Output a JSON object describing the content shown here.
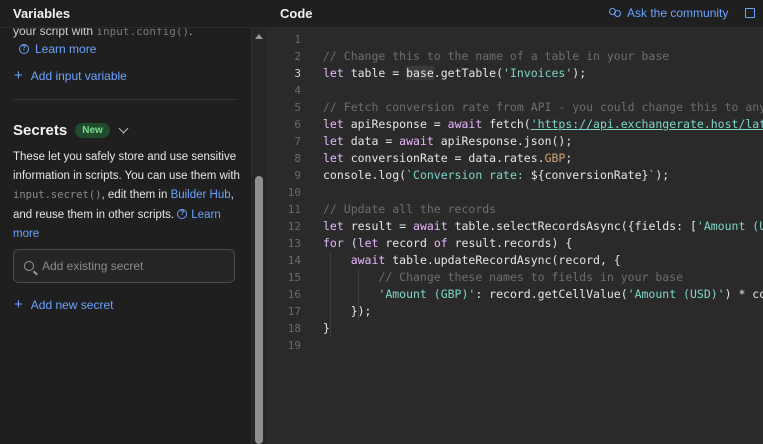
{
  "left_panel": {
    "title": "Variables",
    "partial_line_text": "your script with ",
    "partial_line_code": "input.config()",
    "partial_line_tail": ".",
    "learn_more_1": "Learn more",
    "add_input_variable": "Add input variable",
    "secrets": {
      "title": "Secrets",
      "badge": "New",
      "desc_part1": "These let you safely store and use sensitive information in scripts. You can use them with ",
      "desc_code": "input.secret()",
      "desc_part2": ", edit them in ",
      "desc_link": "Builder Hub",
      "desc_part3": ", and reuse them in other scripts.",
      "learn_more": "Learn more",
      "search_placeholder": "Add existing secret",
      "add_new_secret": "Add new secret"
    }
  },
  "right_panel": {
    "title": "Code",
    "ask_community": "Ask the community"
  },
  "colors": {
    "accent": "#6aa3ff",
    "badge_bg": "#1f4d2b",
    "badge_text": "#7bdc8f",
    "editor_bg": "#2a2a2a"
  },
  "code": {
    "line_numbers": [
      "1",
      "2",
      "3",
      "4",
      "5",
      "6",
      "7",
      "8",
      "9",
      "10",
      "11",
      "12",
      "13",
      "14",
      "15",
      "16",
      "17",
      "18",
      "19"
    ],
    "l2": "// Change this to the name of a table in your base",
    "l3_kw": "let",
    "l3_a": " table = ",
    "l3_b": "base",
    "l3_c": ".getTable(",
    "l3_str": "'Invoices'",
    "l3_d": ");",
    "l5": "// Fetch conversion rate from API - you could change this to any API you want",
    "l6_kw": "let",
    "l6_a": " apiResponse = ",
    "l6_kw2": "await",
    "l6_b": " fetch(",
    "l6_url": "'https://api.exchangerate.host/latest?base=USD'",
    "l6_c": ");",
    "l7_kw": "let",
    "l7_a": " data = ",
    "l7_kw2": "await",
    "l7_b": " apiResponse.json();",
    "l8_kw": "let",
    "l8_a": " conversionRate = data.rates.",
    "l8_b": "GBP",
    "l8_c": ";",
    "l9_a": "console.log(",
    "l9_str": "`Conversion rate: ",
    "l9_b": "${conversionRate}",
    "l9_str2": "`",
    "l9_c": ");",
    "l11": "// Update all the records",
    "l12_kw": "let",
    "l12_a": " result = ",
    "l12_kw2": "await",
    "l12_b": " table.selectRecordsAsync({fields: [",
    "l12_str": "'Amount (USD)'",
    "l12_c": "]});",
    "l13_kw": "for",
    "l13_a": " (",
    "l13_kw2": "let",
    "l13_b": " record ",
    "l13_kw3": "of",
    "l13_c": " result.records) {",
    "l14_kw": "await",
    "l14_a": " table.updateRecordAsync(record, {",
    "l15": "// Change these names to fields in your base",
    "l16_str": "'Amount (GBP)'",
    "l16_a": ": record.getCellValue(",
    "l16_str2": "'Amount (USD)'",
    "l16_b": ") * conversionRate",
    "l17": "});",
    "l18": "}"
  }
}
